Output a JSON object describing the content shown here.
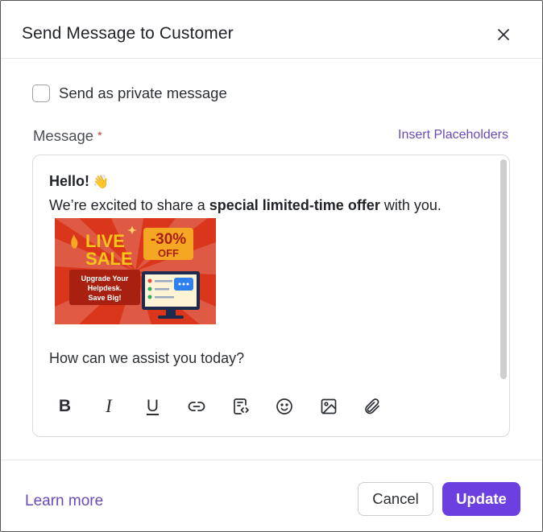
{
  "dialog": {
    "title": "Send Message to Customer",
    "close_icon": "close-icon"
  },
  "private_message": {
    "label": "Send as private message",
    "checked": false
  },
  "message": {
    "label": "Message",
    "required_marker": "*",
    "insert_placeholders": "Insert Placeholders",
    "greeting": "Hello!",
    "greeting_emoji": "👋",
    "offer_intro": "We’re excited to share a ",
    "offer_bold": "special limited-time offer",
    "offer_outro": " with you.",
    "question": "How can we assist you today?",
    "banner": {
      "badge_left_line1": "LIVE",
      "badge_left_line2": "SALE",
      "discount": "-30%",
      "discount_sub": "OFF",
      "ribbon_line1": "Upgrade Your",
      "ribbon_line2": "Helpdesk.",
      "ribbon_line3": "Save Big!",
      "colors": {
        "bg": "#d9361c",
        "accent": "#f5a623",
        "ribbon": "#a8200f"
      }
    }
  },
  "toolbar": {
    "bold": "B",
    "italic": "I",
    "underline": "U",
    "icons": [
      "bold-icon",
      "italic-icon",
      "underline-icon",
      "link-icon",
      "code-snippet-icon",
      "emoji-icon",
      "image-icon",
      "attachment-icon"
    ]
  },
  "footer": {
    "learn_more": "Learn more",
    "cancel_label": "Cancel",
    "update_label": "Update"
  },
  "colors": {
    "accent": "#6c3fe0",
    "link": "#6a4bb5",
    "required": "#c0392b"
  }
}
